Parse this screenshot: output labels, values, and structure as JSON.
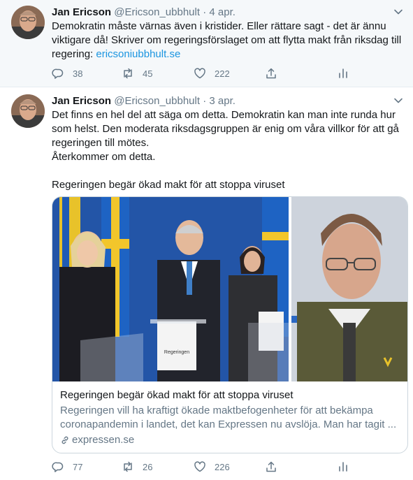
{
  "tweets": [
    {
      "name": "Jan Ericson",
      "handle": "@Ericson_ubbhult",
      "separator": "·",
      "date": "4 apr.",
      "text_line1": "Demokratin måste värnas även i kristider. Eller rättare sagt - det är ännu",
      "text_line2": "viktigare då! Skriver om regeringsförslaget om att flytta makt från riksdag till",
      "text_line3_prefix": "regering: ",
      "text_link": "ericsoniubbhult.se",
      "replies": "38",
      "retweets": "45",
      "likes": "222"
    },
    {
      "name": "Jan Ericson",
      "handle": "@Ericson_ubbhult",
      "separator": "·",
      "date": "3 apr.",
      "text_line1": "Det finns en hel del att säga om detta. Demokratin kan man inte runda hur",
      "text_line2": "som helst. Den moderata riksdagsgruppen är enig om våra villkor för att gå",
      "text_line3": "regeringen till mötes.",
      "text_line4": "Återkommer om detta.",
      "text_line5": "Regeringen begär ökad makt för att stoppa viruset",
      "card": {
        "title": "Regeringen begär ökad makt för att stoppa viruset",
        "desc_line1": "Regeringen vill ha kraftigt ökade maktbefogenheter för att bekämpa",
        "desc_line2": "coronapandemin i landet, det kan Expressen nu avslöja. Man har tagit ...",
        "domain": "expressen.se",
        "podium_sign": "Regeringen"
      },
      "replies": "77",
      "retweets": "26",
      "likes": "226"
    }
  ],
  "colors": {
    "link": "#1b95e0",
    "secondary_text": "#657786",
    "highlight_bg": "#f5f8fa",
    "border": "#e6ecf0"
  },
  "icons": [
    "chevron-down-icon",
    "reply-icon",
    "retweet-icon",
    "like-icon",
    "share-icon",
    "analytics-icon",
    "link-icon"
  ]
}
